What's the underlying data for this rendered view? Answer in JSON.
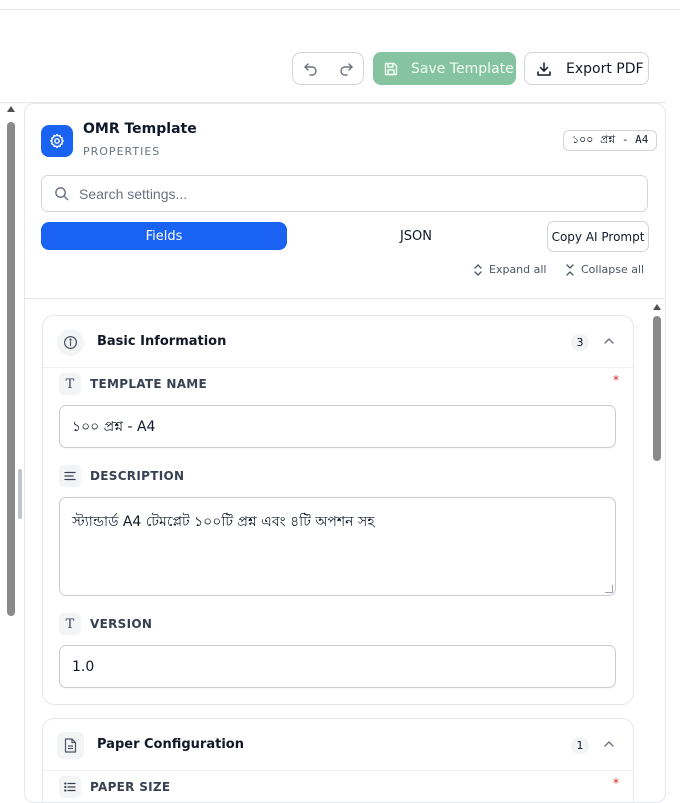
{
  "toolbar": {
    "save_label": "Save Template",
    "export_label": "Export PDF",
    "icons": [
      "undo-icon",
      "redo-icon",
      "save-icon",
      "download-icon"
    ]
  },
  "panel": {
    "title": "OMR Template",
    "subtitle": "PROPERTIES",
    "badge": "১০০ প্রশ্ন - A4",
    "search_placeholder": "Search settings...",
    "tabs": [
      {
        "label": "Fields",
        "active": true
      },
      {
        "label": "JSON",
        "active": false
      }
    ],
    "copy_prompt_label": "Copy AI Prompt",
    "expand_all_label": "Expand all",
    "collapse_all_label": "Collapse all",
    "accent_color": "#1a63f2"
  },
  "sections": [
    {
      "title": "Basic Information",
      "count": "3",
      "icon": "info-icon",
      "fields": [
        {
          "label": "TEMPLATE NAME",
          "icon": "text-type-icon",
          "required": true,
          "value": "১০০ প্রশ্ন - A4"
        },
        {
          "label": "DESCRIPTION",
          "icon": "align-left-icon",
          "required": false,
          "value": "স্ট্যান্ডার্ড A4 টেমপ্লেট ১০০টি প্রশ্ন এবং ৪টি অপশন সহ"
        },
        {
          "label": "VERSION",
          "icon": "text-type-icon",
          "required": false,
          "value": "1.0"
        }
      ]
    },
    {
      "title": "Paper Configuration",
      "count": "1",
      "icon": "document-icon",
      "fields": [
        {
          "label": "PAPER SIZE",
          "icon": "list-icon",
          "required": true,
          "value": ""
        }
      ]
    }
  ],
  "required_mark": "*"
}
